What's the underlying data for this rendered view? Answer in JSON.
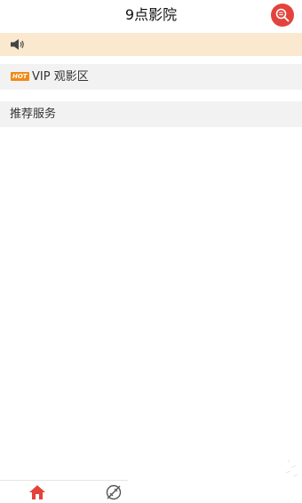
{
  "header": {
    "title": "9点影院",
    "search_icon": "search-icon"
  },
  "notice": {
    "icon": "speaker-icon",
    "text": ""
  },
  "sections": {
    "vip": {
      "badge": "HOT",
      "label": "VIP 观影区"
    },
    "recommend": {
      "label": "推荐服务"
    }
  },
  "tabbar": {
    "items": [
      {
        "icon": "home-icon",
        "active": true
      },
      {
        "icon": "discover-icon",
        "active": false
      }
    ]
  },
  "colors": {
    "accent": "#e3433c",
    "notice_bg": "#fbe9cf",
    "section_bg": "#f2f2f2",
    "hot_badge": "#f08a17"
  }
}
